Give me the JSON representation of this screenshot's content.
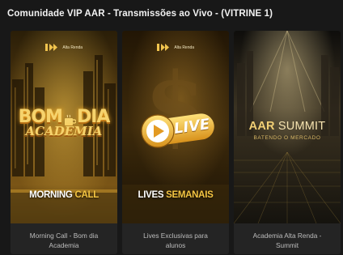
{
  "section": {
    "title": "Comunidade VIP AAR - Transmissões ao Vivo - (VITRINE 1)"
  },
  "cards": [
    {
      "logo_text": "Alta Renda",
      "art_title_1": "BOM",
      "art_title_2": "DIA",
      "art_subtitle": "ACADEMIA",
      "bottom_white": "MORNING",
      "bottom_gold": "CALL",
      "caption_line1": "Morning Call - Bom dia",
      "caption_line2": "Academia"
    },
    {
      "logo_text": "Alta Renda",
      "art_badge": "LIVE",
      "bottom_white": "LIVES",
      "bottom_gold": "SEMANAIS",
      "caption_line1": "Lives Exclusivas para",
      "caption_line2": "alunos"
    },
    {
      "art_title_a": "AAR",
      "art_title_b": "SUMMIT",
      "art_subtitle": "BATENDO O MERCADO",
      "caption_line1": "Academia Alta Renda -",
      "caption_line2": "Summit"
    }
  ],
  "colors": {
    "accent_gold": "#f4c542",
    "background": "#181818",
    "card": "#242424"
  }
}
